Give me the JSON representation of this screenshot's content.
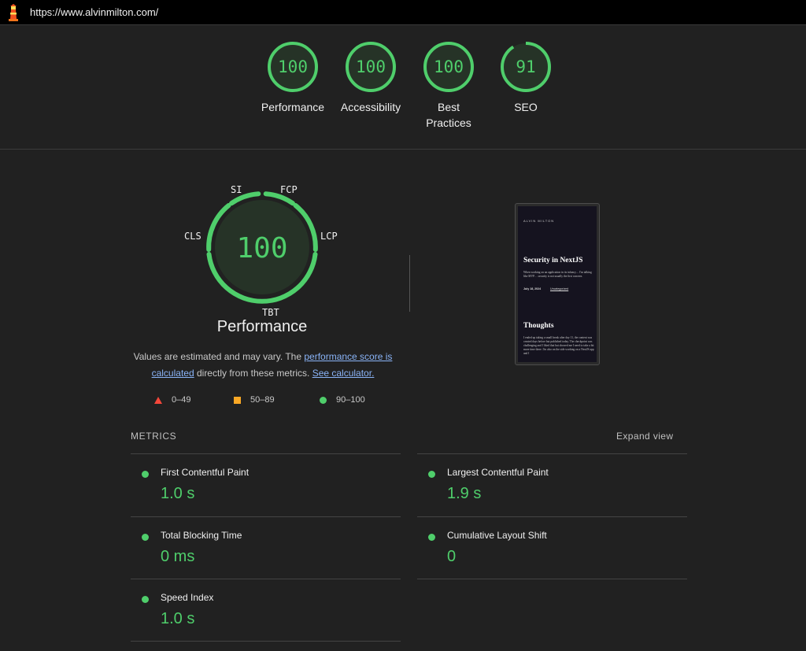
{
  "browser": {
    "url": "https://www.alvinmilton.com/"
  },
  "summary_gauges": [
    {
      "score": "100",
      "label": "Performance"
    },
    {
      "score": "100",
      "label": "Accessibility"
    },
    {
      "score": "100",
      "label": "Best Practices"
    },
    {
      "score": "91",
      "label": "SEO"
    }
  ],
  "performance": {
    "score": "100",
    "title": "Performance",
    "abbr": {
      "si": "SI",
      "fcp": "FCP",
      "lcp": "LCP",
      "cls": "CLS",
      "tbt": "TBT"
    },
    "desc_prefix": "Values are estimated and may vary. The ",
    "desc_link1": "performance score is calculated",
    "desc_mid": " directly from these metrics. ",
    "desc_link2": "See calculator."
  },
  "legend": [
    {
      "range": "0–49",
      "icon": "triangle-icon",
      "color": "#f4473a"
    },
    {
      "range": "50–89",
      "icon": "square-icon",
      "color": "#f9a825"
    },
    {
      "range": "90–100",
      "icon": "circle-icon",
      "color": "#4fce6b"
    }
  ],
  "thumbnail": {
    "brand": "ALVIN MILTON",
    "heading": "Security in NextJS",
    "body": "When working on an application in its infancy… I'm talking like MVP… security is not usually the first concern.",
    "date": "July 18, 2024",
    "category": "Uncategorized",
    "heading2": "Thoughts",
    "body2": "I ended up taking a small break after day 11, the content was created days before but published today. The checkpoint was challenging and I liked that but showed me I need to take a bit more time there. I'm also on the side working on a NextJS app and I"
  },
  "metrics": {
    "title": "METRICS",
    "expand_label": "Expand view",
    "items": [
      {
        "name": "First Contentful Paint",
        "value": "1.0 s"
      },
      {
        "name": "Largest Contentful Paint",
        "value": "1.9 s"
      },
      {
        "name": "Total Blocking Time",
        "value": "0 ms"
      },
      {
        "name": "Cumulative Layout Shift",
        "value": "0"
      },
      {
        "name": "Speed Index",
        "value": "1.0 s"
      }
    ]
  },
  "colors": {
    "pass": "#4fce6b",
    "pass_bg": "#263327",
    "background": "#212121"
  }
}
